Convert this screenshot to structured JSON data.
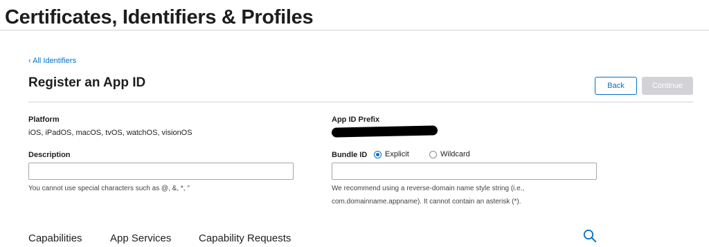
{
  "header": {
    "title": "Certificates, Identifiers & Profiles"
  },
  "nav": {
    "back_link": "‹ All Identifiers"
  },
  "main": {
    "title": "Register an App ID",
    "back_button": "Back",
    "continue_button": "Continue",
    "platform": {
      "label": "Platform",
      "value": "iOS, iPadOS, macOS, tvOS, watchOS, visionOS"
    },
    "app_id_prefix": {
      "label": "App ID Prefix"
    },
    "description": {
      "label": "Description",
      "value": "",
      "help": "You cannot use special characters such as @, &, *, \""
    },
    "bundle_id": {
      "label": "Bundle ID",
      "options": [
        {
          "label": "Explicit",
          "selected": true
        },
        {
          "label": "Wildcard",
          "selected": false
        }
      ],
      "value": "",
      "help_line1": "We recommend using a reverse-domain name style string (i.e.,",
      "help_line2": "com.domainname.appname). It cannot contain an asterisk (*)."
    },
    "tabs": [
      {
        "label": "Capabilities"
      },
      {
        "label": "App Services"
      },
      {
        "label": "Capability Requests"
      }
    ]
  },
  "colors": {
    "accent": "#0070c9",
    "disabled_button": "#d2d2d7",
    "divider": "#d2d2d7",
    "text": "#1d1d1f"
  },
  "icons": {
    "search": "search-icon"
  }
}
